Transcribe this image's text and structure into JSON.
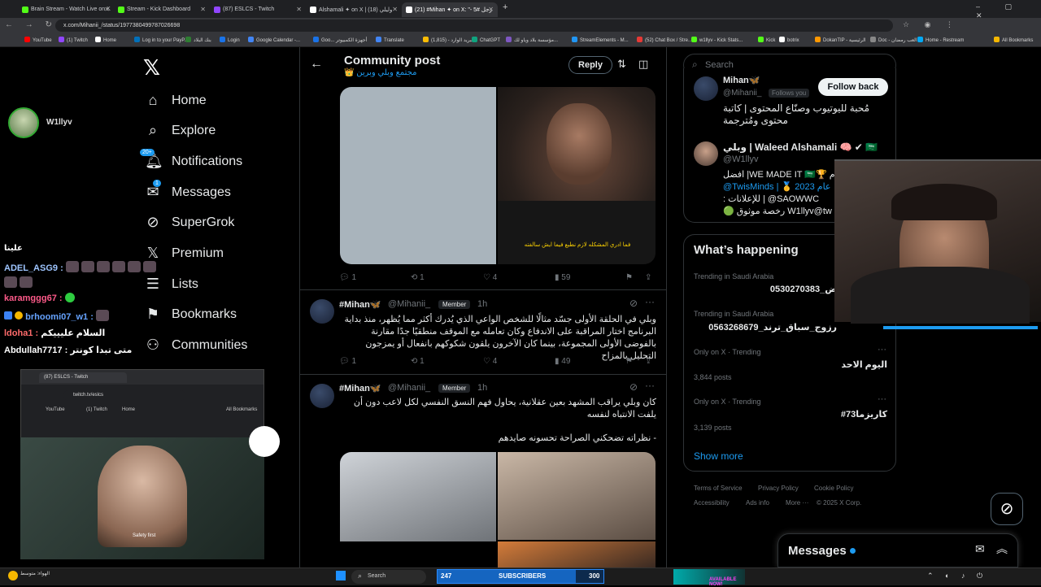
{
  "browser": {
    "tabs": [
      {
        "title": "Brain Stream - Watch Live on K",
        "color": "#53fc18"
      },
      {
        "title": "Stream - Kick Dashboard",
        "color": "#53fc18"
      },
      {
        "title": "(87) ESLCS - Twitch",
        "color": "#9146ff"
      },
      {
        "title": "Alshamali ✦ on X | وليلي (18)",
        "color": "#ffffff"
      },
      {
        "title": "(21) #Mihan ✦ on X: \"- 5# رجل",
        "color": "#ffffff"
      }
    ],
    "url": "x.com/Mihanii_/status/1977380499787026698",
    "bookmarks": [
      "YouTube",
      "(1) Twitch",
      "Home",
      "Log in to your PayP...",
      "بنك البلاد",
      "Login",
      "Google Calendar -...",
      "Goo... أجهزة الكمبيوتر",
      "Translate",
      "البريد الوارد - (1,815)",
      "ChatGPT",
      "مؤسسة بلاد وياو لك...",
      "StreamElements - M...",
      "(52) Chat Box / Stre...",
      "w1llyv - Kick Stats...",
      "Kick",
      "botrix",
      "DokanTIP - الرئيسية",
      "Doc - العب رمضان",
      "Home - Restream",
      "All Bookmarks"
    ]
  },
  "stream": {
    "streamer_name": "W1llyv",
    "chat_header": "علينا",
    "chat": [
      {
        "user": "ADEL_ASG9 :",
        "msg": ""
      },
      {
        "user": "karamggg67 :",
        "msg": ""
      },
      {
        "user": "brhoomi07_w1 :",
        "msg": ""
      },
      {
        "user": "ldoha1 :",
        "msg": "السلام عليييكم"
      },
      {
        "user": "Abdullah7717 :",
        "msg": "متى تبدا كونتر"
      }
    ],
    "popup": {
      "tab_title": "(87) ESLCS - Twitch",
      "url": "twitch.tv/eslcs",
      "bookmarks": [
        "YouTube",
        "(1) Twitch",
        "Home",
        "All Bookmarks"
      ],
      "caption": "Safety first"
    }
  },
  "nav": {
    "items": [
      {
        "label": "Home",
        "icon": "home-icon",
        "glyph": "⌂"
      },
      {
        "label": "Explore",
        "icon": "search-icon",
        "glyph": "⌕"
      },
      {
        "label": "Notifications",
        "icon": "bell-icon",
        "glyph": "🔔",
        "badge": "20+"
      },
      {
        "label": "Messages",
        "icon": "mail-icon",
        "glyph": "✉",
        "badge": "1"
      },
      {
        "label": "SuperGrok",
        "icon": "grok-icon",
        "glyph": "⊘"
      },
      {
        "label": "Premium",
        "icon": "x-icon",
        "glyph": "𝕏"
      },
      {
        "label": "Lists",
        "icon": "list-icon",
        "glyph": "☰"
      },
      {
        "label": "Bookmarks",
        "icon": "bookmark-icon",
        "glyph": "⚑"
      },
      {
        "label": "Communities",
        "icon": "people-icon",
        "glyph": "👥"
      }
    ]
  },
  "header": {
    "title": "Community post",
    "subtitle": "مجتمع وبلي وبرين 👑",
    "reply_label": "Reply"
  },
  "post1": {
    "image_caption": "فما ادري المشكله لازم نطبع فيما ايش سالفته",
    "stats": {
      "replies": "1",
      "reposts": "1",
      "likes": "4",
      "views": "59"
    }
  },
  "reply1": {
    "name": "#Mihan🦋",
    "handle": "@Mihanii_",
    "badge": "Member",
    "time": "1h",
    "text": "وبلي في الحلقة الأولى جسّد مثالًا للشخص الواعي الذي يُدرك أكثر مما يُظهر، منذ بداية البرنامج اختار المراقبة على الاندفاع وكان تعامله مع الموقف منطقيًا جدًا مقارنة بالفوضى الأولى المجموعة، بينما كان الآخرون يلقون شكوكهم بانفعال أو يمزجون التحليل بالمزاح",
    "stats": {
      "replies": "1",
      "reposts": "1",
      "likes": "4",
      "views": "49"
    }
  },
  "reply2": {
    "name": "#Mihan🦋",
    "handle": "@Mihanii_",
    "badge": "Member",
    "time": "1h",
    "text": "كان وبلي يراقب المشهد بعين عقلانية، يحاول فهم النسق النفسي لكل لاعب دون أن يلفت الانتباه لنفسه",
    "text2": "- نظراته تضحكني الصراحة تحسونه صايدهم"
  },
  "right": {
    "search_placeholder": "Search",
    "profile1": {
      "name": "Mihan🦋",
      "handle": "@Mihanii_",
      "follows_you": "Follows you",
      "follow_back": "Follow back",
      "bio": "مُحبة لليوتيوب وصنّاع المحتوى | كاتبة محتوى ومُترجمة"
    },
    "profile2": {
      "name": "وبلي | Waleed Alshamali 🧠 ✔ 🇸🇦",
      "handle": "@W1llyv",
      "bio1": "افضل |WE MADE IT 🇸🇦🏆 م",
      "bio2": "@TwisMinds | 🥇 عام 2023",
      "bio3": ": للإعلانات | @SAOWWC",
      "bio4": "🟢 رخصة موثوق W1llyv@tw"
    },
    "happening": {
      "title": "What’s happening",
      "trends": [
        {
          "context": "Trending in Saudi Arabia",
          "topic": "ض_0530270383",
          "posts": ""
        },
        {
          "context": "Trending in Saudi Arabia",
          "topic": "رزوج_سباق_ترند_0563268679",
          "posts": ""
        },
        {
          "context": "Only on X · Trending",
          "topic": "اليوم الاحد",
          "posts": "3,844 posts"
        },
        {
          "context": "Only on X · Trending",
          "topic": "#كاريزما73",
          "posts": "3,139 posts"
        }
      ],
      "show_more": "Show more"
    },
    "footer": [
      "Terms of Service",
      "Privacy Policy",
      "Cookie Policy",
      "Accessibility",
      "Ads info",
      "More ···",
      "© 2025 X Corp."
    ],
    "messages": "Messages"
  },
  "taskbar": {
    "weather": "الهواء: متوسط",
    "search": "Search",
    "subs_count": "247",
    "subs_label": "SUBSCRIBERS",
    "subs_goal": "300",
    "promo": "AVAILABLE NOW!"
  }
}
